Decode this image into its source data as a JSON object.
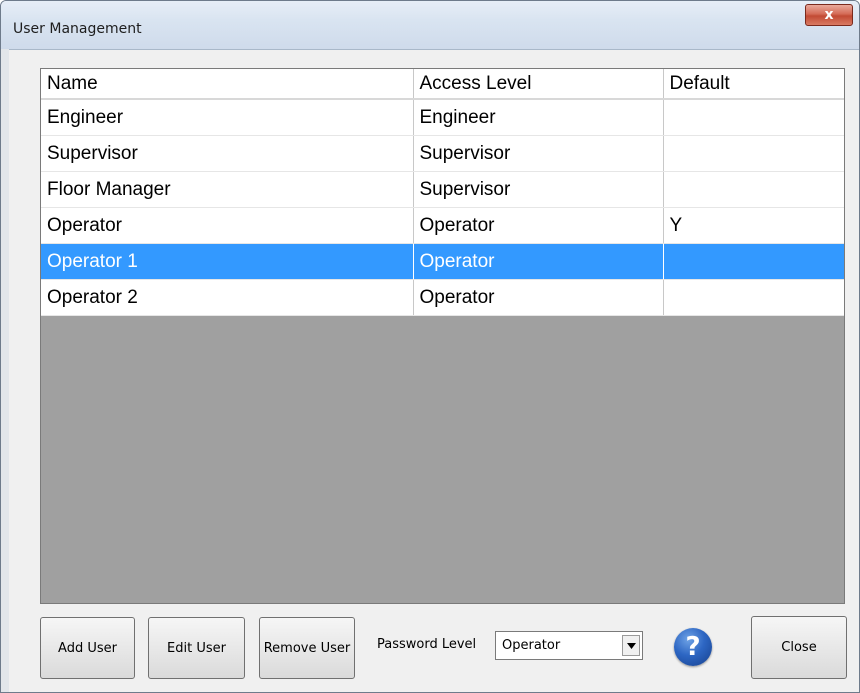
{
  "window": {
    "title": "User Management",
    "close_glyph": "x"
  },
  "grid": {
    "columns": [
      "Name",
      "Access Level",
      "Default"
    ],
    "rows": [
      {
        "name": "Engineer",
        "access": "Engineer",
        "default": ""
      },
      {
        "name": "Supervisor",
        "access": "Supervisor",
        "default": ""
      },
      {
        "name": "Floor Manager",
        "access": "Supervisor",
        "default": ""
      },
      {
        "name": "Operator",
        "access": "Operator",
        "default": "Y"
      },
      {
        "name": "Operator 1",
        "access": "Operator",
        "default": "",
        "selected": true
      },
      {
        "name": "Operator 2",
        "access": "Operator",
        "default": ""
      }
    ]
  },
  "buttons": {
    "add": "Add User",
    "edit": "Edit User",
    "remove": "Remove User",
    "close": "Close"
  },
  "password_level": {
    "label": "Password Level",
    "value": "Operator"
  },
  "icons": {
    "help": "help-icon",
    "dropdown": "chevron-down-icon"
  },
  "colors": {
    "selection": "#3399ff",
    "grid_background": "#a0a0a0",
    "help": "#2d66c3"
  }
}
